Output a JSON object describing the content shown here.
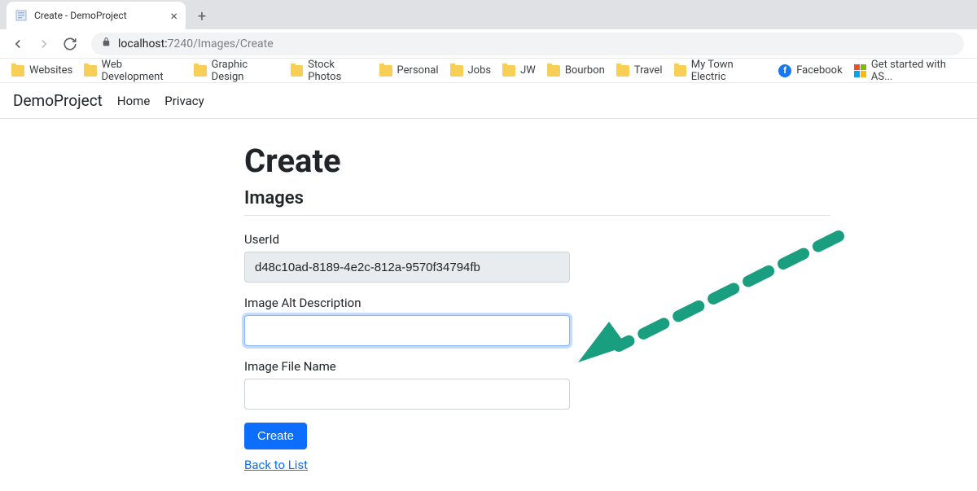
{
  "browser": {
    "tab_title": "Create - DemoProject",
    "url_host": "localhost:",
    "url_port": "7240",
    "url_path": "/Images/Create"
  },
  "bookmarks": [
    {
      "type": "folder",
      "label": "Websites"
    },
    {
      "type": "folder",
      "label": "Web Development"
    },
    {
      "type": "folder",
      "label": "Graphic Design"
    },
    {
      "type": "folder",
      "label": "Stock Photos"
    },
    {
      "type": "folder",
      "label": "Personal"
    },
    {
      "type": "folder",
      "label": "Jobs"
    },
    {
      "type": "folder",
      "label": "JW"
    },
    {
      "type": "folder",
      "label": "Bourbon"
    },
    {
      "type": "folder",
      "label": "Travel"
    },
    {
      "type": "folder",
      "label": "My Town Electric"
    },
    {
      "type": "site",
      "label": "Facebook",
      "icon": "facebook"
    },
    {
      "type": "site",
      "label": "Get started with AS...",
      "icon": "microsoft"
    }
  ],
  "nav": {
    "brand": "DemoProject",
    "links": [
      "Home",
      "Privacy"
    ]
  },
  "page": {
    "heading": "Create",
    "subheading": "Images"
  },
  "form": {
    "userid_label": "UserId",
    "userid_value": "d48c10ad-8189-4e2c-812a-9570f34794fb",
    "alt_label": "Image Alt Description",
    "alt_value": "",
    "filename_label": "Image File Name",
    "filename_value": "",
    "submit_label": "Create",
    "back_label": "Back to List"
  },
  "annotation": {
    "color": "#199e7f"
  }
}
